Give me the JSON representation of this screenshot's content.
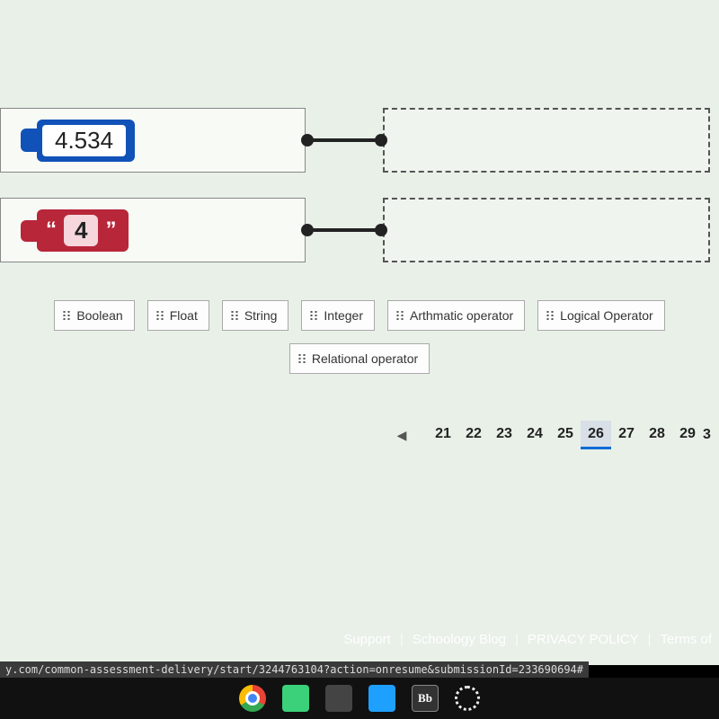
{
  "question": {
    "items": [
      {
        "display": "4.534",
        "kind": "float"
      },
      {
        "display": "4",
        "kind": "string"
      }
    ]
  },
  "string_quote_open": "“",
  "string_quote_close": "”",
  "answer_bank": [
    "Boolean",
    "Float",
    "String",
    "Integer",
    "Arthmatic operator",
    "Logical Operator",
    "Relational operator"
  ],
  "pager": {
    "prev_glyph": "◀",
    "pages": [
      "21",
      "22",
      "23",
      "24",
      "25",
      "26",
      "27",
      "28",
      "29"
    ],
    "active": "26",
    "trailing_fragment": "3"
  },
  "footer": {
    "links": [
      "Support",
      "Schoology Blog",
      "PRIVACY POLICY",
      "Terms of"
    ]
  },
  "status_url": "y.com/common-assessment-delivery/start/3244763104?action=onresume&submissionId=233690694#",
  "taskbar": {
    "bb_label": "Bb"
  }
}
